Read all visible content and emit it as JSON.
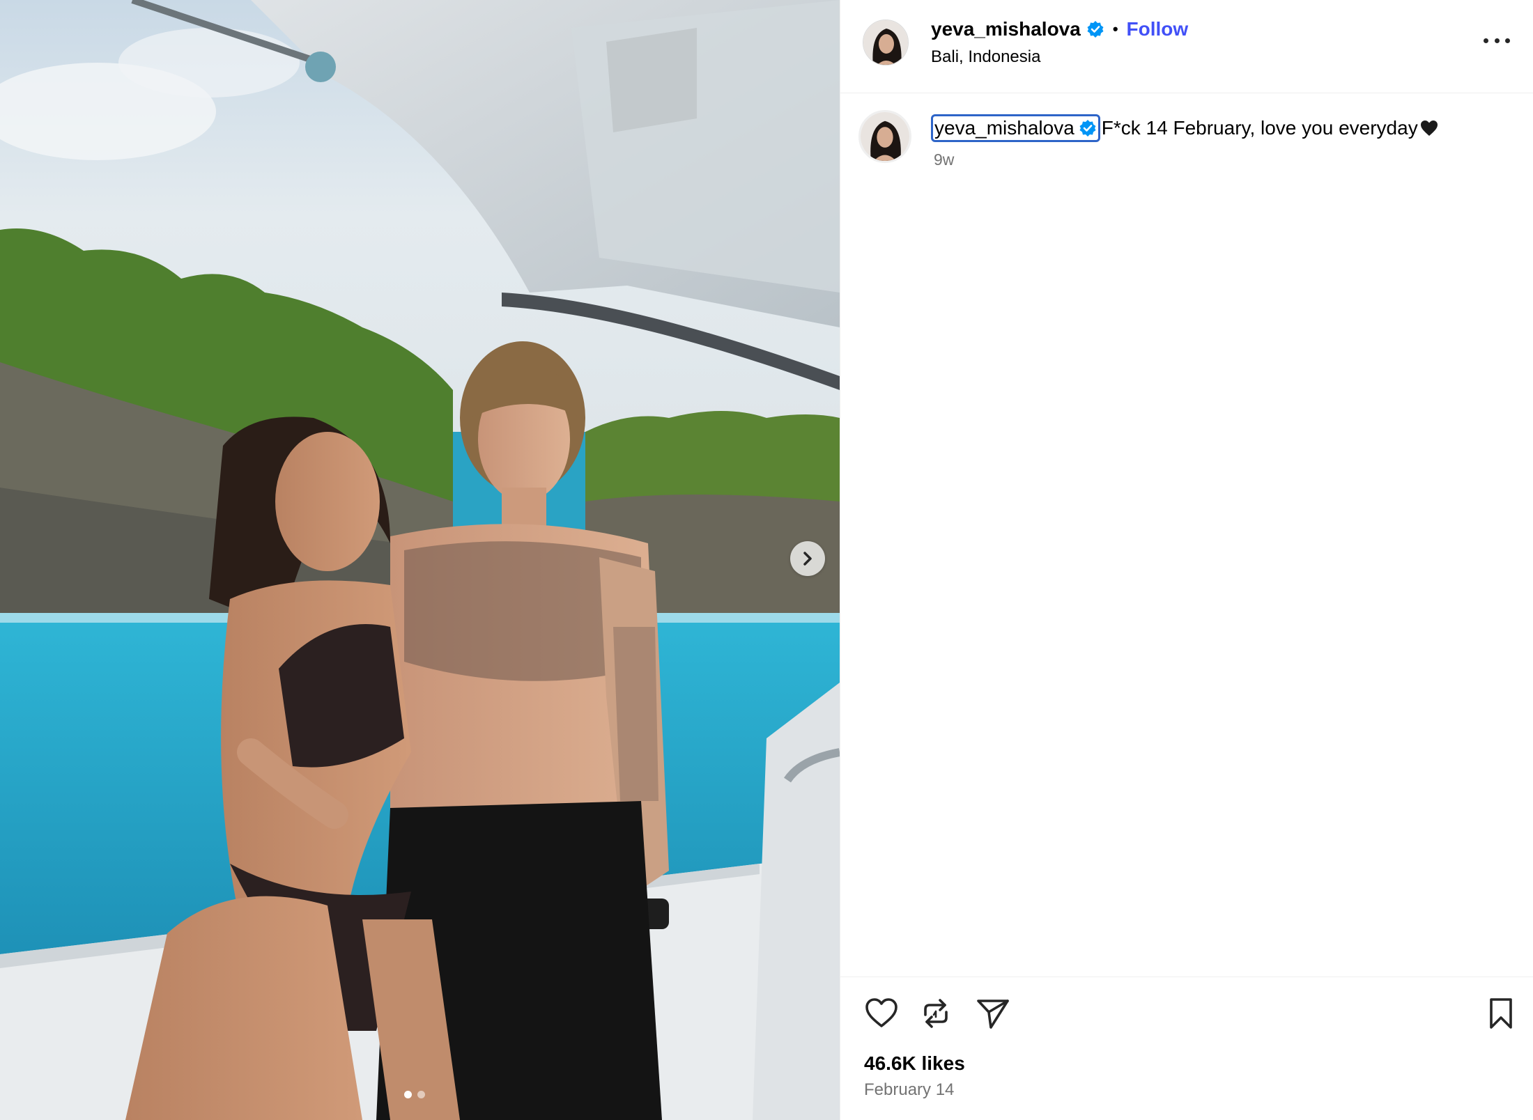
{
  "post": {
    "username": "yeva_mishalova",
    "verified": true,
    "follow_label": "Follow",
    "separator": "•",
    "location": "Bali, Indonesia",
    "more_label": "More options"
  },
  "caption": {
    "username": "yeva_mishalova",
    "text": "F*ck 14 February, love you everyday",
    "emoji": "black-heart",
    "time": "9w"
  },
  "stats": {
    "likes": "46.6K likes",
    "date": "February 14"
  },
  "carousel": {
    "current_index": 1,
    "total": 2
  },
  "colors": {
    "follow": "#4150f7",
    "verified": "#0095f6",
    "muted": "#737373",
    "divider": "#efefef"
  },
  "icons": [
    "like-icon",
    "repost-icon",
    "share-icon",
    "save-icon",
    "more-icon",
    "chevron-right-icon",
    "verified-icon"
  ]
}
